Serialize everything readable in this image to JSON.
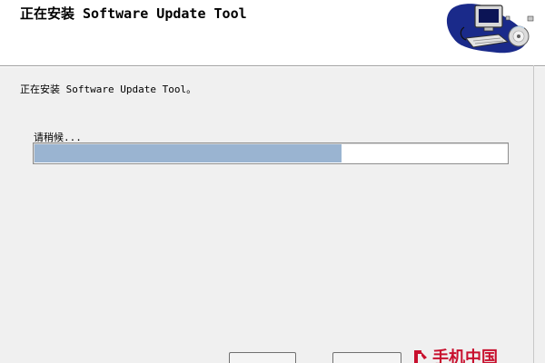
{
  "header": {
    "title": "正在安装 Software Update Tool",
    "logo_icon": "computer-disc-setup-icon"
  },
  "status": {
    "message": "正在安装 Software Update Tool。"
  },
  "progress": {
    "label": "请稍候...",
    "percent": 65
  },
  "buttons": {
    "primary_label": "",
    "secondary_label": ""
  },
  "watermark": {
    "text": "手机中国",
    "icon": "brand-logo-icon"
  },
  "colors": {
    "progress_fill": "#9ab4d1",
    "header_bg": "#ffffff",
    "body_bg": "#f0f0f0",
    "watermark": "#c8102e"
  }
}
